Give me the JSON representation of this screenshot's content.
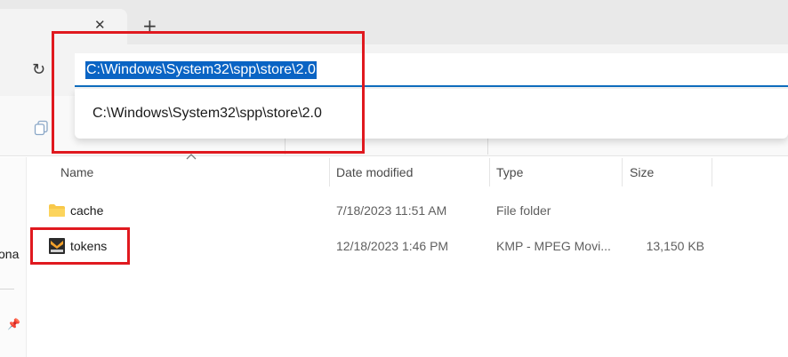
{
  "window": {
    "tab_close_glyph": "✕",
    "new_tab_glyph": "+",
    "refresh_glyph": "↻"
  },
  "address_bar": {
    "value": "C:\\Windows\\System32\\spp\\store\\2.0",
    "suggestion": "C:\\Windows\\System32\\spp\\store\\2.0"
  },
  "nav_pane": {
    "partial_label": "ona",
    "pin_icon": "pin-icon"
  },
  "columns": {
    "name": "Name",
    "date": "Date modified",
    "type": "Type",
    "size": "Size"
  },
  "files": [
    {
      "name": "cache",
      "date": "7/18/2023 11:51 AM",
      "type": "File folder",
      "size": "",
      "icon": "folder-icon"
    },
    {
      "name": "tokens",
      "date": "12/18/2023 1:46 PM",
      "type": "KMP - MPEG Movi...",
      "size": "13,150 KB",
      "icon": "kmp-video-icon"
    }
  ],
  "colors": {
    "accent": "#0f6cbd",
    "selection": "#0a64c4",
    "annotation": "#e0191f",
    "folder": "#f8c84a"
  }
}
